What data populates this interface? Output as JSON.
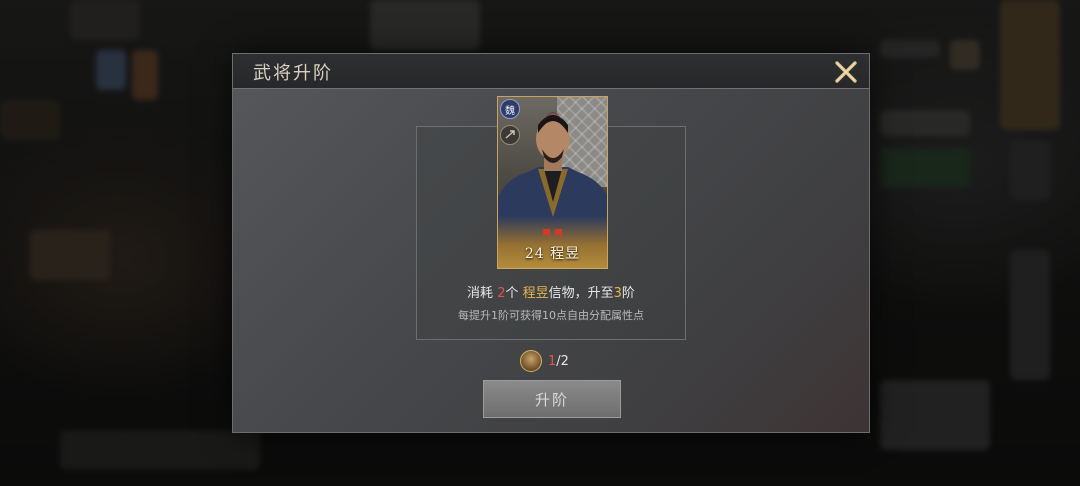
{
  "dialog": {
    "title": "武将升阶",
    "close_icon": "close-x-icon"
  },
  "hero_card": {
    "faction": "魏",
    "arms_icon": "crossbow-arms-icon",
    "rank_icon": "rank-chevron-icon",
    "level": "24",
    "name": "程昱",
    "border_color": "#c9a45a"
  },
  "consume": {
    "prefix": "消耗 ",
    "count": "2",
    "unit": "个 ",
    "item_name": "程昱",
    "item_suffix": "信物，升至",
    "target_stage": "3",
    "stage_suffix": "阶"
  },
  "hint": "每提升1阶可获得10点自由分配属性点",
  "owned": {
    "icon": "token-icon",
    "current": "1",
    "required": "/2"
  },
  "advance_button": {
    "label": "升阶"
  },
  "colors": {
    "highlight_red": "#e0564a",
    "highlight_gold": "#e8b450"
  }
}
